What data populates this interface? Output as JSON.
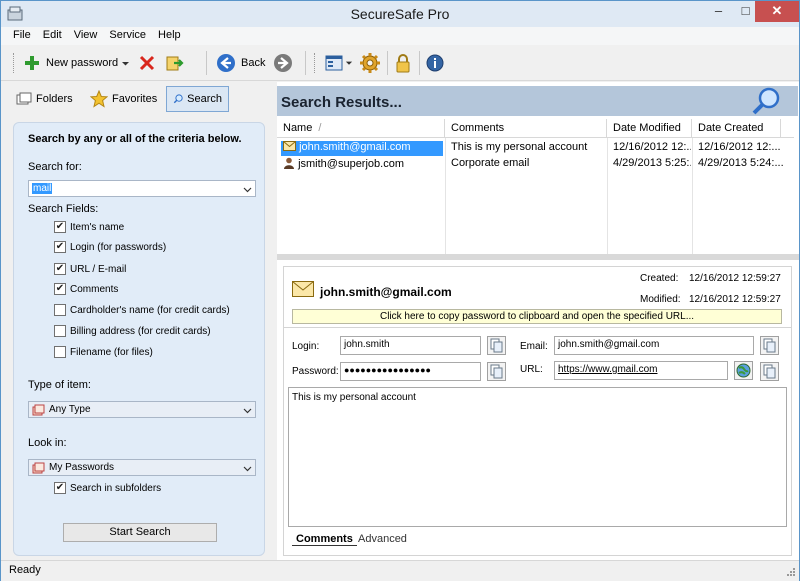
{
  "app": {
    "title": "SecureSafe Pro"
  },
  "menu": [
    "File",
    "Edit",
    "View",
    "Service",
    "Help"
  ],
  "toolbar": {
    "new_password_label": "New password",
    "back_label": "Back"
  },
  "left_tabs": {
    "folders": "Folders",
    "favorites": "Favorites",
    "search": "Search"
  },
  "search_panel": {
    "heading": "Search by any or all of the criteria below.",
    "search_for_label": "Search for:",
    "search_for_value": "mail",
    "search_fields_label": "Search Fields:",
    "fields": [
      {
        "label": "Item's name",
        "checked": true
      },
      {
        "label": "Login (for passwords)",
        "checked": true
      },
      {
        "label": "URL / E-mail",
        "checked": true
      },
      {
        "label": "Comments",
        "checked": true
      },
      {
        "label": "Cardholder's name (for credit cards)",
        "checked": false
      },
      {
        "label": "Billing address (for credit cards)",
        "checked": false
      },
      {
        "label": "Filename (for files)",
        "checked": false
      }
    ],
    "type_label": "Type of item:",
    "type_value": "Any Type",
    "look_in_label": "Look in:",
    "look_in_value": "My Passwords",
    "subfolders_label": "Search in subfolders",
    "subfolders_checked": true,
    "start_button": "Start Search"
  },
  "results": {
    "title": "Search Results...",
    "columns": [
      "Name",
      "Comments",
      "Date Modified",
      "Date Created"
    ],
    "rows": [
      {
        "name": "john.smith@gmail.com",
        "comments": "This is my personal account",
        "modified": "12/16/2012 12:...",
        "created": "12/16/2012 12:..."
      },
      {
        "name": "jsmith@superjob.com",
        "comments": "Corporate email",
        "modified": "4/29/2013 5:25:...",
        "created": "4/29/2013 5:24:..."
      }
    ]
  },
  "detail": {
    "title": "john.smith@gmail.com",
    "created_label": "Created:",
    "created_value": "12/16/2012 12:59:27",
    "modified_label": "Modified:",
    "modified_value": "12/16/2012 12:59:27",
    "copy_bar": "Click here to copy password to clipboard and open the specified URL...",
    "login_label": "Login:",
    "login_value": "john.smith",
    "email_label": "Email:",
    "email_value": "john.smith@gmail.com",
    "password_label": "Password:",
    "password_value": "●●●●●●●●●●●●●●●●",
    "url_label": "URL:",
    "url_value": "https://www.gmail.com",
    "notes": "This is my personal account",
    "tab_comments": "Comments",
    "tab_advanced": "Advanced"
  },
  "status": {
    "text": "Ready"
  },
  "colors": {
    "selection": "#3399ff",
    "results_header": "#b4c6da",
    "panel_bg": "#e1ecf8",
    "close_button": "#c75050"
  }
}
